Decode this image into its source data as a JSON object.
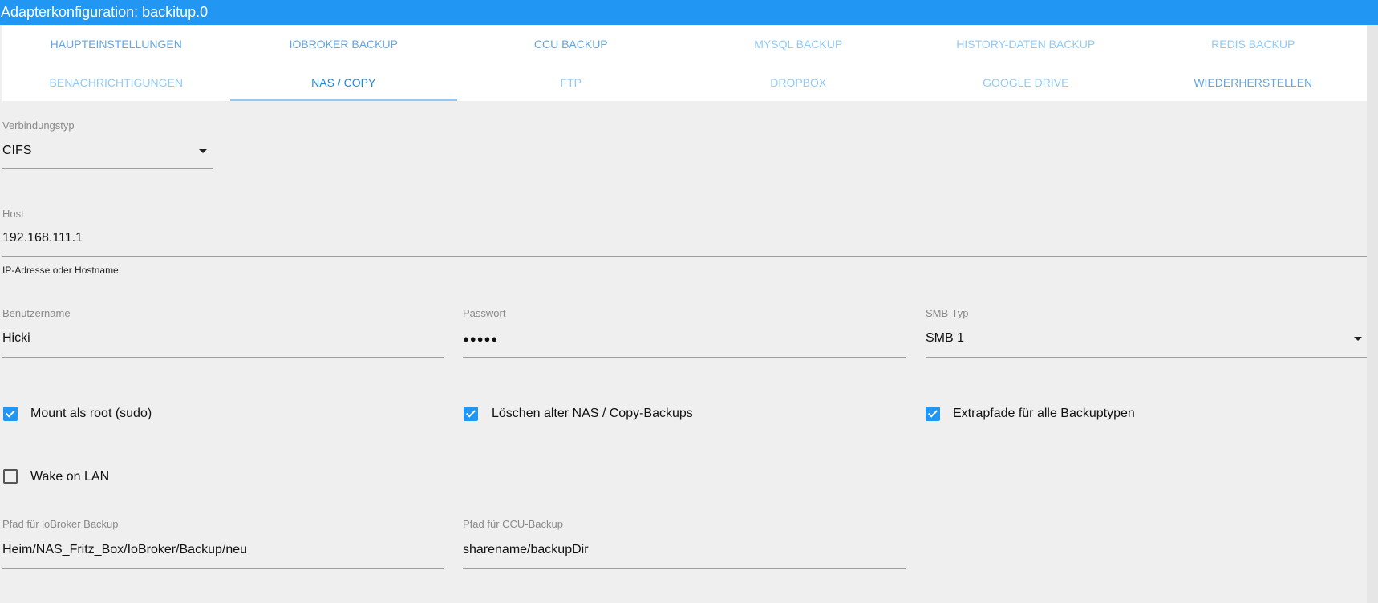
{
  "header": {
    "title": "Adapterkonfiguration: backitup.0"
  },
  "tabs_row1": [
    "HAUPTEINSTELLUNGEN",
    "IOBROKER BACKUP",
    "CCU BACKUP",
    "MYSQL BACKUP",
    "HISTORY-DATEN BACKUP",
    "REDIS BACKUP"
  ],
  "tabs_row2": [
    "BENACHRICHTIGUNGEN",
    "NAS / COPY",
    "FTP",
    "DROPBOX",
    "GOOGLE DRIVE",
    "WIEDERHERSTELLEN"
  ],
  "active_tab": "NAS / COPY",
  "form": {
    "connection_type": {
      "label": "Verbindungstyp",
      "value": "CIFS"
    },
    "host": {
      "label": "Host",
      "value": "192.168.111.1",
      "helper": "IP-Adresse oder Hostname"
    },
    "username": {
      "label": "Benutzername",
      "value": "Hicki"
    },
    "password": {
      "label": "Passwort",
      "value": "●●●●●"
    },
    "smb_type": {
      "label": "SMB-Typ",
      "value": "SMB 1"
    },
    "mount_root": {
      "label": "Mount als root (sudo)",
      "checked": true
    },
    "delete_old": {
      "label": "Löschen alter NAS / Copy-Backups",
      "checked": true
    },
    "extra_paths": {
      "label": "Extrapfade für alle Backuptypen",
      "checked": true
    },
    "wake_on_lan": {
      "label": "Wake on LAN",
      "checked": false
    },
    "iobroker_path": {
      "label": "Pfad für ioBroker Backup",
      "value": "Heim/NAS_Fritz_Box/IoBroker/Backup/neu"
    },
    "ccu_path": {
      "label": "Pfad für CCU-Backup",
      "value": "sharename/backupDir"
    }
  },
  "colors": {
    "accent": "#2196f3",
    "tab_inactive": "#90caf9",
    "background": "#efefef"
  }
}
